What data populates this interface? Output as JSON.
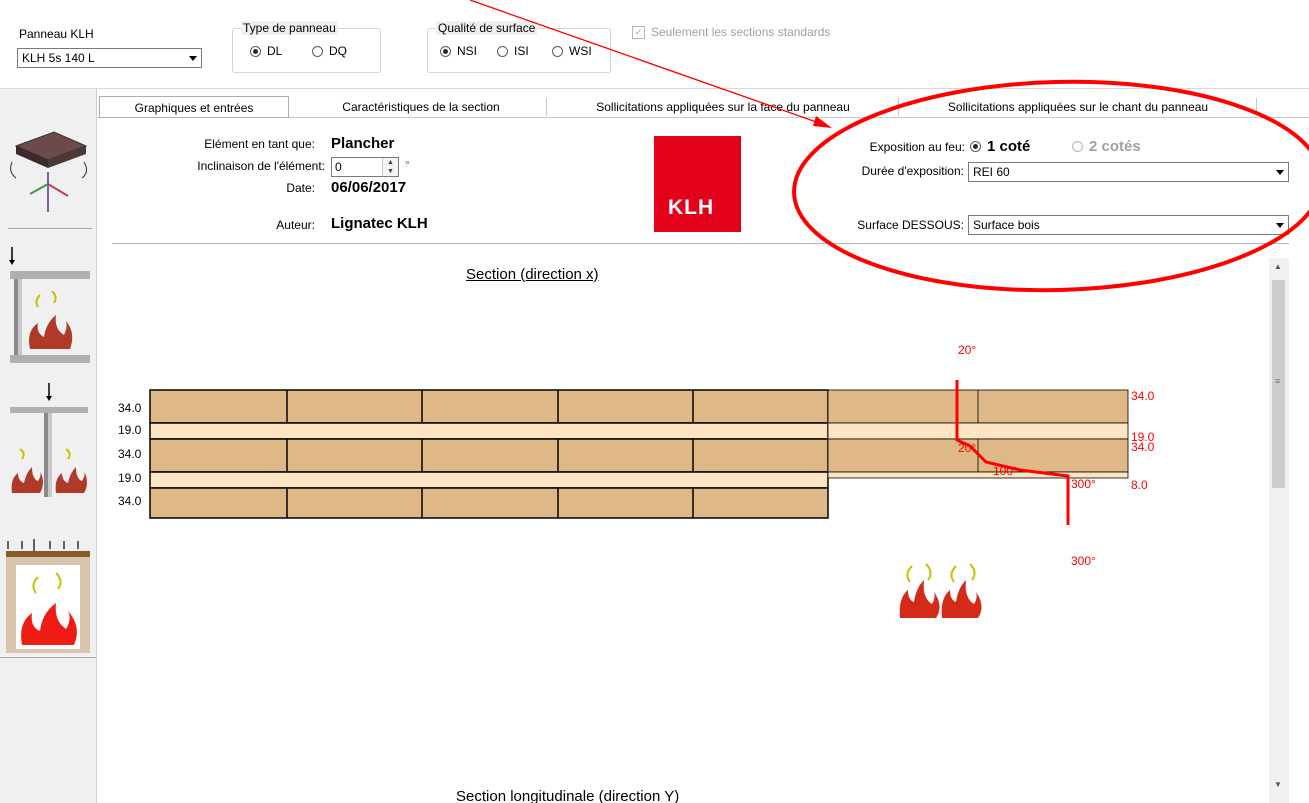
{
  "panel": {
    "label": "Panneau KLH",
    "value": "KLH 5s 140 L"
  },
  "panel_type": {
    "title": "Type de panneau",
    "options": [
      "DL",
      "DQ"
    ],
    "selected": "DL"
  },
  "surface_quality": {
    "title": "Qualité de surface",
    "options": [
      "NSI",
      "ISI",
      "WSI"
    ],
    "selected": "NSI"
  },
  "standard_only": {
    "label": "Seulement les sections standards",
    "checked": true,
    "enabled": false
  },
  "tabs": [
    {
      "label": "Graphiques et entrées",
      "active": true
    },
    {
      "label": "Caractéristiques de la section",
      "active": false
    },
    {
      "label": "Sollicitations appliquées sur la face du panneau",
      "active": false
    },
    {
      "label": "Sollicitations appliquées sur le chant du panneau",
      "active": false
    }
  ],
  "element": {
    "as_label": "Elément en tant que:",
    "as_value": "Plancher",
    "incline_label": "Inclinaison de l'élément:",
    "incline_value": "0",
    "incline_unit": "°",
    "date_label": "Date:",
    "date_value": "06/06/2017",
    "author_label": "Auteur:",
    "author_value": "Lignatec KLH"
  },
  "logo": {
    "text": "KLH",
    "color": "#e2001a"
  },
  "fire": {
    "exposure_label": "Exposition au feu:",
    "exposure_options": [
      "1 coté",
      "2 cotés"
    ],
    "exposure_selected": "1 coté",
    "duration_label": "Durée d'exposition:",
    "duration_value": "REI 60",
    "surface_label": "Surface DESSOUS:",
    "surface_value": "Surface bois"
  },
  "section": {
    "title": "Section (direction x)",
    "layers": [
      "34.0",
      "19.0",
      "34.0",
      "19.0",
      "34.0"
    ],
    "right_layers": [
      "34.0",
      "19.0",
      "34.0",
      "8.0"
    ],
    "temperature_labels": [
      "20°",
      "20°",
      "100°",
      "300°",
      "300°"
    ],
    "bottom_title": "Section longitudinale (direction Y)"
  },
  "colors": {
    "wood": "#deb887",
    "wood_light": "#fde5c4",
    "annotation": "#ff0000",
    "flame": "#d42a1a"
  }
}
